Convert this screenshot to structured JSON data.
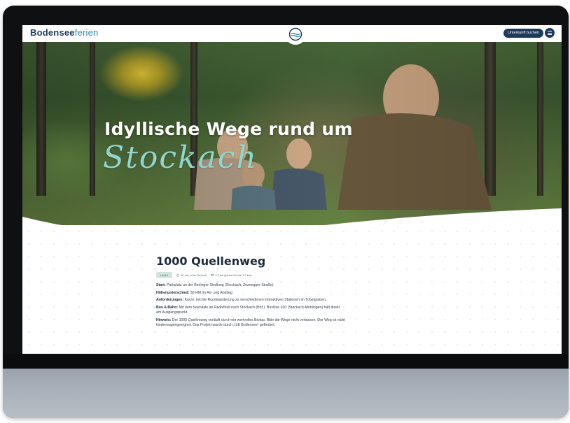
{
  "nav": {
    "logo_bold": "Bodensee",
    "logo_light": "ferien",
    "book_label": "Unterkunft buchen"
  },
  "hero": {
    "title": "Idyllische Wege rund um",
    "script_title": "Stockach"
  },
  "route": {
    "title": "1000 Quellenweg",
    "difficulty": "Leicht",
    "duration": "40 min reine Gehzeit",
    "distance": "2,2 km (kleine Runde 1,2 km)"
  },
  "info": {
    "start_label": "Start:",
    "start_text": "Parkplatz an der Berlinger Siedlung (Stockach, Zoznegger Straße)",
    "height_label": "Höhenunterschied:",
    "height_text": "50 HM im An- und Abstieg",
    "req_label": "Anforderungen:",
    "req_text": "Kurze, leichte Rundwanderung zu verschiedenen interaktiven Stationen im Tobelgraben.",
    "bus_label": "Bus & Bahn:",
    "bus_text": "Mit dem Seehäsle ab Radolfzell nach Stockach (Bhf.). Buslinie 100 (Stockach-Mühlingen) hält direkt am Ausgangspunkt.",
    "hint_label": "Hinweis:",
    "hint_text": "Der 1000 Quellenweg verläuft durch ein wertvolles Biotop. Bitte die Wege nicht verlassen. Der Weg ist nicht kinderwagengeeignet. Das Projekt wurde durch „ILE Bodensee“ gefördert."
  },
  "colors": {
    "brand_navy": "#1c3a5c",
    "brand_teal": "#2b8db5",
    "script_mint": "#8fd6cf",
    "badge_green": "#cfe6dc"
  },
  "icons": {
    "center": "lake-wave-icon",
    "menu": "hamburger-menu-icon",
    "duration": "clock-icon",
    "distance": "route-icon"
  }
}
